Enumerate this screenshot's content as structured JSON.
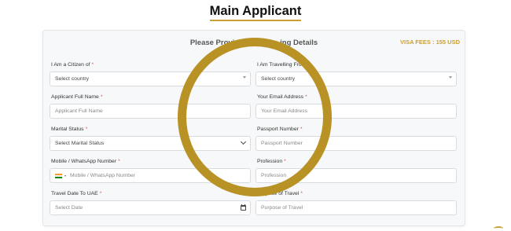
{
  "page": {
    "title": "Main Applicant"
  },
  "card": {
    "heading": "Please Provid",
    "heading_tail": "ing Details",
    "visa_fees": "VISA FEES : 155 USD"
  },
  "form": {
    "citizen_label": "I Am a Citizen of",
    "citizen_value": "Select country",
    "travelling_label": "I Am Travelling Fro",
    "travelling_value": "Select country",
    "full_name_label": "Applicant Full Name",
    "full_name_placeholder": "Applicant Full Name",
    "email_label": "Your Email Address",
    "email_placeholder": "Your Email Address",
    "marital_label": "Marital Status",
    "marital_value": "Select Marital Status",
    "passport_label": "Passport Number",
    "passport_placeholder": "Passport Number",
    "mobile_label": "Mobile / WhatsApp Number",
    "mobile_placeholder": "Mobile / WhatsApp Number",
    "profession_label": "Profession",
    "profession_placeholder": "Profession",
    "travel_date_label": "Travel Date To UAE",
    "travel_date_placeholder": "Select Date",
    "purpose_label": "Purpose of Travel",
    "purpose_placeholder": "Purpose of Travel",
    "required_mark": "*"
  },
  "colors": {
    "accent": "#c9a032",
    "ring": "#b99226",
    "required": "#d9534f"
  },
  "icons": {
    "country_flag": "india-flag-icon",
    "calendar": "calendar-icon",
    "dropdown": "chevron-down-icon"
  }
}
